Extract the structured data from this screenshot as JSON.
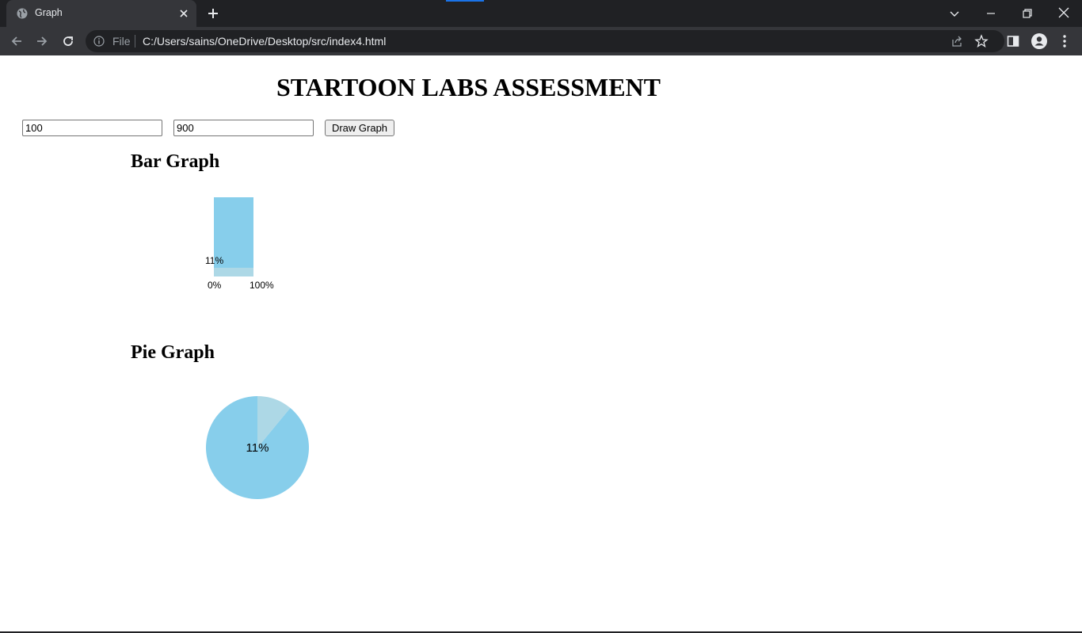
{
  "browser": {
    "tab_title": "Graph",
    "file_label": "File",
    "url": "C:/Users/sains/OneDrive/Desktop/src/index4.html"
  },
  "page": {
    "title": "STARTOON LABS ASSESSMENT",
    "input1_value": "100",
    "input2_value": "900",
    "draw_button_label": "Draw Graph",
    "bar_heading": "Bar Graph",
    "pie_heading": "Pie Graph"
  },
  "colors": {
    "bar_main": "#87ceeb",
    "bar_light": "#add8e6",
    "pie_main": "#87ceeb",
    "pie_light": "#add8e6"
  },
  "chart_data": [
    {
      "type": "bar",
      "values": [
        11,
        100
      ],
      "labels": [
        "11%",
        "0%",
        "100%"
      ],
      "value_label": "11%",
      "axis_labels": [
        "0%",
        "100%"
      ]
    },
    {
      "type": "pie",
      "values": [
        11,
        89
      ],
      "center_label": "11%"
    }
  ]
}
